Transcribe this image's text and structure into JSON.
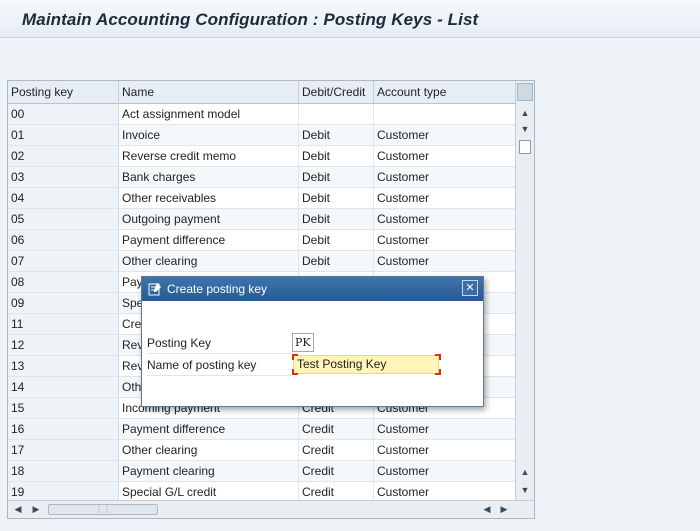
{
  "window": {
    "title": "Maintain Accounting Configuration : Posting Keys - List"
  },
  "toolbar": {
    "icons": [
      "display-change-icon",
      "new-entries-icon",
      "delete-icon"
    ]
  },
  "table": {
    "columns": [
      "Posting key",
      "Name",
      "Debit/Credit",
      "Account type"
    ],
    "rows": [
      {
        "key": "00",
        "name": "Act assignment model",
        "dc": "",
        "acc": ""
      },
      {
        "key": "01",
        "name": "Invoice",
        "dc": "Debit",
        "acc": "Customer"
      },
      {
        "key": "02",
        "name": "Reverse credit memo",
        "dc": "Debit",
        "acc": "Customer"
      },
      {
        "key": "03",
        "name": "Bank charges",
        "dc": "Debit",
        "acc": "Customer"
      },
      {
        "key": "04",
        "name": "Other receivables",
        "dc": "Debit",
        "acc": "Customer"
      },
      {
        "key": "05",
        "name": "Outgoing payment",
        "dc": "Debit",
        "acc": "Customer"
      },
      {
        "key": "06",
        "name": "Payment difference",
        "dc": "Debit",
        "acc": "Customer"
      },
      {
        "key": "07",
        "name": "Other clearing",
        "dc": "Debit",
        "acc": "Customer"
      },
      {
        "key": "08",
        "name": "Pay",
        "dc": "",
        "acc": ""
      },
      {
        "key": "09",
        "name": "Spec",
        "dc": "",
        "acc": ""
      },
      {
        "key": "11",
        "name": "Cred",
        "dc": "",
        "acc": ""
      },
      {
        "key": "12",
        "name": "Reve",
        "dc": "",
        "acc": ""
      },
      {
        "key": "13",
        "name": "Reve",
        "dc": "",
        "acc": ""
      },
      {
        "key": "14",
        "name": "Oth",
        "dc": "",
        "acc": ""
      },
      {
        "key": "15",
        "name": "Incoming payment",
        "dc": "Credit",
        "acc": "Customer"
      },
      {
        "key": "16",
        "name": "Payment difference",
        "dc": "Credit",
        "acc": "Customer"
      },
      {
        "key": "17",
        "name": "Other clearing",
        "dc": "Credit",
        "acc": "Customer"
      },
      {
        "key": "18",
        "name": "Payment clearing",
        "dc": "Credit",
        "acc": "Customer"
      },
      {
        "key": "19",
        "name": "Special G/L credit",
        "dc": "Credit",
        "acc": "Customer"
      }
    ]
  },
  "dialog": {
    "title": "Create posting key",
    "close_icon": "close-icon",
    "fields": {
      "posting_key_label": "Posting Key",
      "posting_key_value": "PK",
      "name_label": "Name of posting key",
      "name_value": "Test Posting Key"
    }
  },
  "colors": {
    "dialog_title_bg": "#255a93",
    "required_marker": "#d6301a",
    "input_focus_bg": "#fff5b8"
  }
}
